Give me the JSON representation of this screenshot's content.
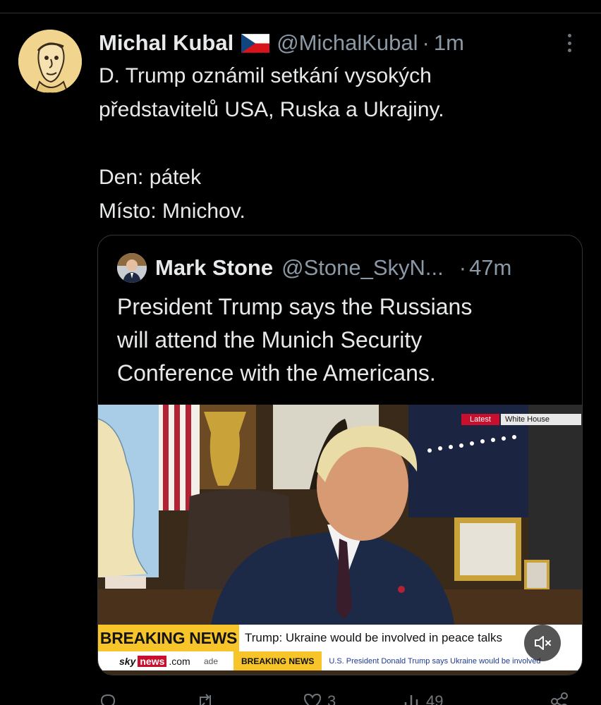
{
  "post": {
    "author_name": "Michal Kubal",
    "handle": "@MichalKubal",
    "separator": "·",
    "time": "1m",
    "lines": [
      "D. Trump oznámil setkání vysokých",
      "představitelů USA, Ruska a Ukrajiny.",
      "",
      "Den: pátek",
      "Místo: Mnichov."
    ]
  },
  "quote": {
    "author_name": "Mark Stone",
    "handle": "@Stone_SkyN...",
    "separator": "·",
    "time": "47m",
    "lines": [
      "President Trump says the Russians",
      "will attend the Munich Security",
      "Conference with the Americans."
    ],
    "video": {
      "tag_latest": "Latest",
      "tag_location": "White House",
      "breaking_label": "BREAKING NEWS",
      "headline": "Trump: Ukraine would be involved in peace talks",
      "ticker_logo_sky": "sky",
      "ticker_logo_news": "news",
      "ticker_logo_com": ".com",
      "ticker_fragment": "ade",
      "ticker_label": "BREAKING NEWS",
      "ticker_text": "U.S. President Donald Trump says Ukraine would be involved",
      "colors": {
        "breaking_yellow": "#f7c42a",
        "sky_red": "#c8102e"
      }
    }
  },
  "actions": {
    "reply_icon": "reply-icon",
    "repost_icon": "repost-icon",
    "like_icon": "heart-icon",
    "like_count": "3",
    "views_icon": "views-icon",
    "views_count": "49",
    "share_icon": "share-icon"
  },
  "icons": {
    "more": "more-vertical-icon",
    "mute": "mute-icon",
    "flag": "flag-cz-icon"
  }
}
